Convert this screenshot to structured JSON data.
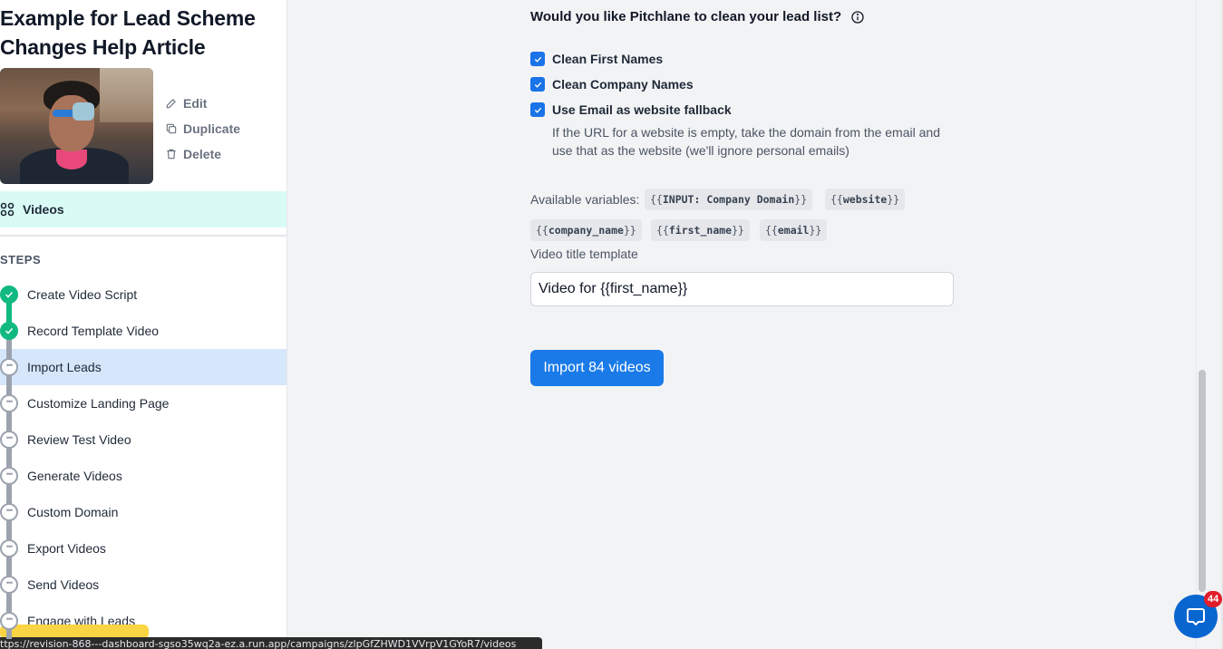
{
  "campaign": {
    "title_line1": "Example for Lead Scheme",
    "title_line2": "Changes Help Article"
  },
  "video_actions": {
    "edit": "Edit",
    "duplicate": "Duplicate",
    "delete": "Delete"
  },
  "videos_tab": {
    "label": "Videos",
    "icon": "grid-icon"
  },
  "steps": {
    "heading": "STEPS",
    "items": [
      {
        "label": "Create Video Script",
        "status": "done"
      },
      {
        "label": "Record Template Video",
        "status": "done"
      },
      {
        "label": "Import Leads",
        "status": "active"
      },
      {
        "label": "Customize Landing Page",
        "status": "todo"
      },
      {
        "label": "Review Test Video",
        "status": "todo"
      },
      {
        "label": "Generate Videos",
        "status": "todo"
      },
      {
        "label": "Custom Domain",
        "status": "todo"
      },
      {
        "label": "Export Videos",
        "status": "todo"
      },
      {
        "label": "Send Videos",
        "status": "todo"
      },
      {
        "label": "Engage with Leads",
        "status": "todo"
      }
    ]
  },
  "main": {
    "question": "Would you like Pitchlane to clean your lead list?",
    "options": [
      {
        "label": "Clean First Names",
        "checked": true
      },
      {
        "label": "Clean Company Names",
        "checked": true
      },
      {
        "label": "Use Email as website fallback",
        "checked": true
      }
    ],
    "fallback_description": "If the URL for a website is empty, take the domain from the email and use that as the website (we'll ignore personal emails)",
    "variables_label": "Available variables:",
    "variables": [
      {
        "open": "{{",
        "name": "INPUT: Company Domain",
        "close": "}}"
      },
      {
        "open": "{{",
        "name": "website",
        "close": "}}"
      },
      {
        "open": "{{",
        "name": "company_name",
        "close": "}}"
      },
      {
        "open": "{{",
        "name": "first_name",
        "close": "}}"
      },
      {
        "open": "{{",
        "name": "email",
        "close": "}}"
      }
    ],
    "title_template_label": "Video title template",
    "title_template_value": "Video for {{first_name}}",
    "import_button": "Import 84 videos"
  },
  "status_bar_url": "ttps://revision-868---dashboard-sgso35wq2a-ez.a.run.app/campaigns/zlpGfZHWD1VVrpV1GYoR7/videos",
  "chat": {
    "badge": "44",
    "icon": "chat-icon"
  },
  "colors": {
    "accent": "#1a7ae8",
    "done": "#10b981",
    "active_row": "#d6e6fb",
    "videos_tab": "#d9fbf6",
    "badge": "#e11d2a"
  }
}
